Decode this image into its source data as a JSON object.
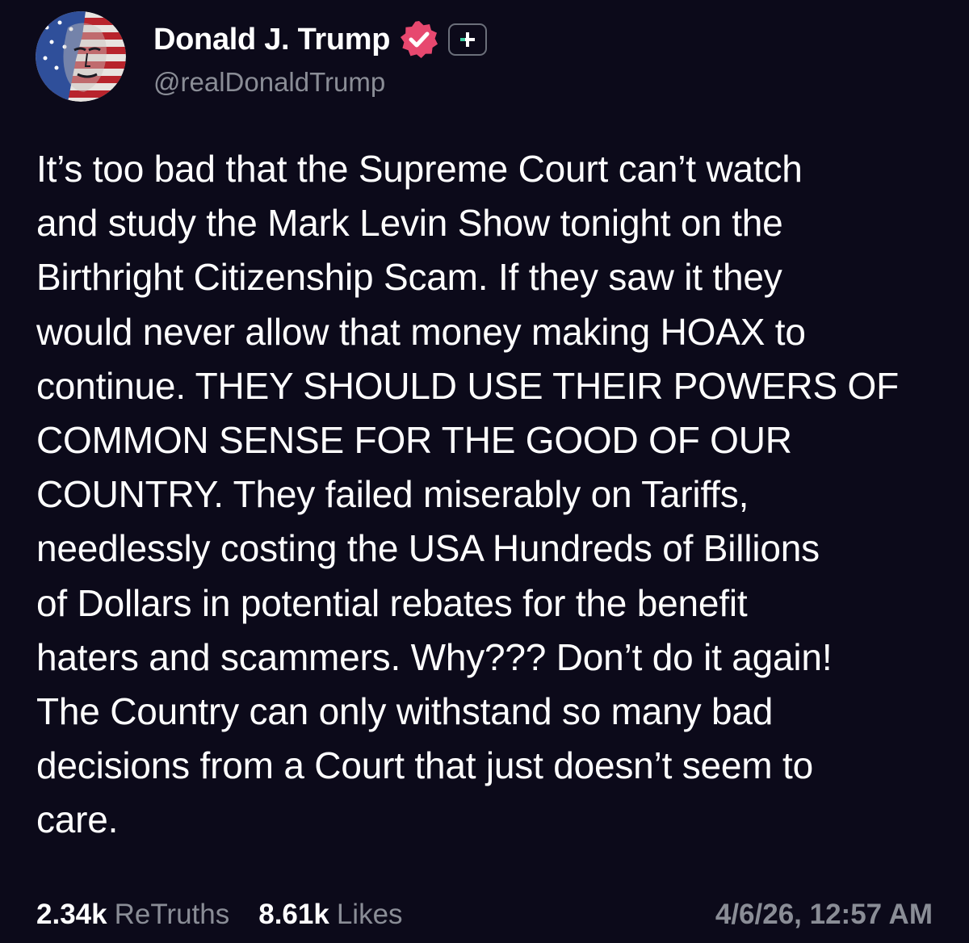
{
  "author": {
    "display_name": "Donald J. Trump",
    "handle": "@realDonaldTrump",
    "avatar_icon": "avatar-flag-portrait",
    "verified_icon": "verified-check-icon",
    "verified_color": "#e7486f",
    "plus_icon": "plus-badge-icon"
  },
  "post": {
    "text": "It’s too bad that the Supreme Court can’t watch\nand study the Mark Levin Show tonight on the\nBirthright Citizenship Scam. If they saw it they\nwould never allow that money making HOAX to\ncontinue. THEY SHOULD USE THEIR POWERS OF\nCOMMON SENSE FOR THE GOOD OF OUR\nCOUNTRY. They failed miserably on Tariffs,\nneedlessly costing the USA Hundreds of Billions\nof Dollars in potential rebates for the benefit\nhaters and scammers. Why??? Don’t do it again!\nThe Country can only withstand so many bad\ndecisions from a Court that just doesn’t seem to\ncare."
  },
  "stats": {
    "retruths_count": "2.34k",
    "retruths_label": "ReTruths",
    "likes_count": "8.61k",
    "likes_label": "Likes"
  },
  "timestamp": "4/6/26, 12:57 AM",
  "colors": {
    "background": "#0c0a1a",
    "text_primary": "#ffffff",
    "text_secondary": "#8a8d96"
  }
}
